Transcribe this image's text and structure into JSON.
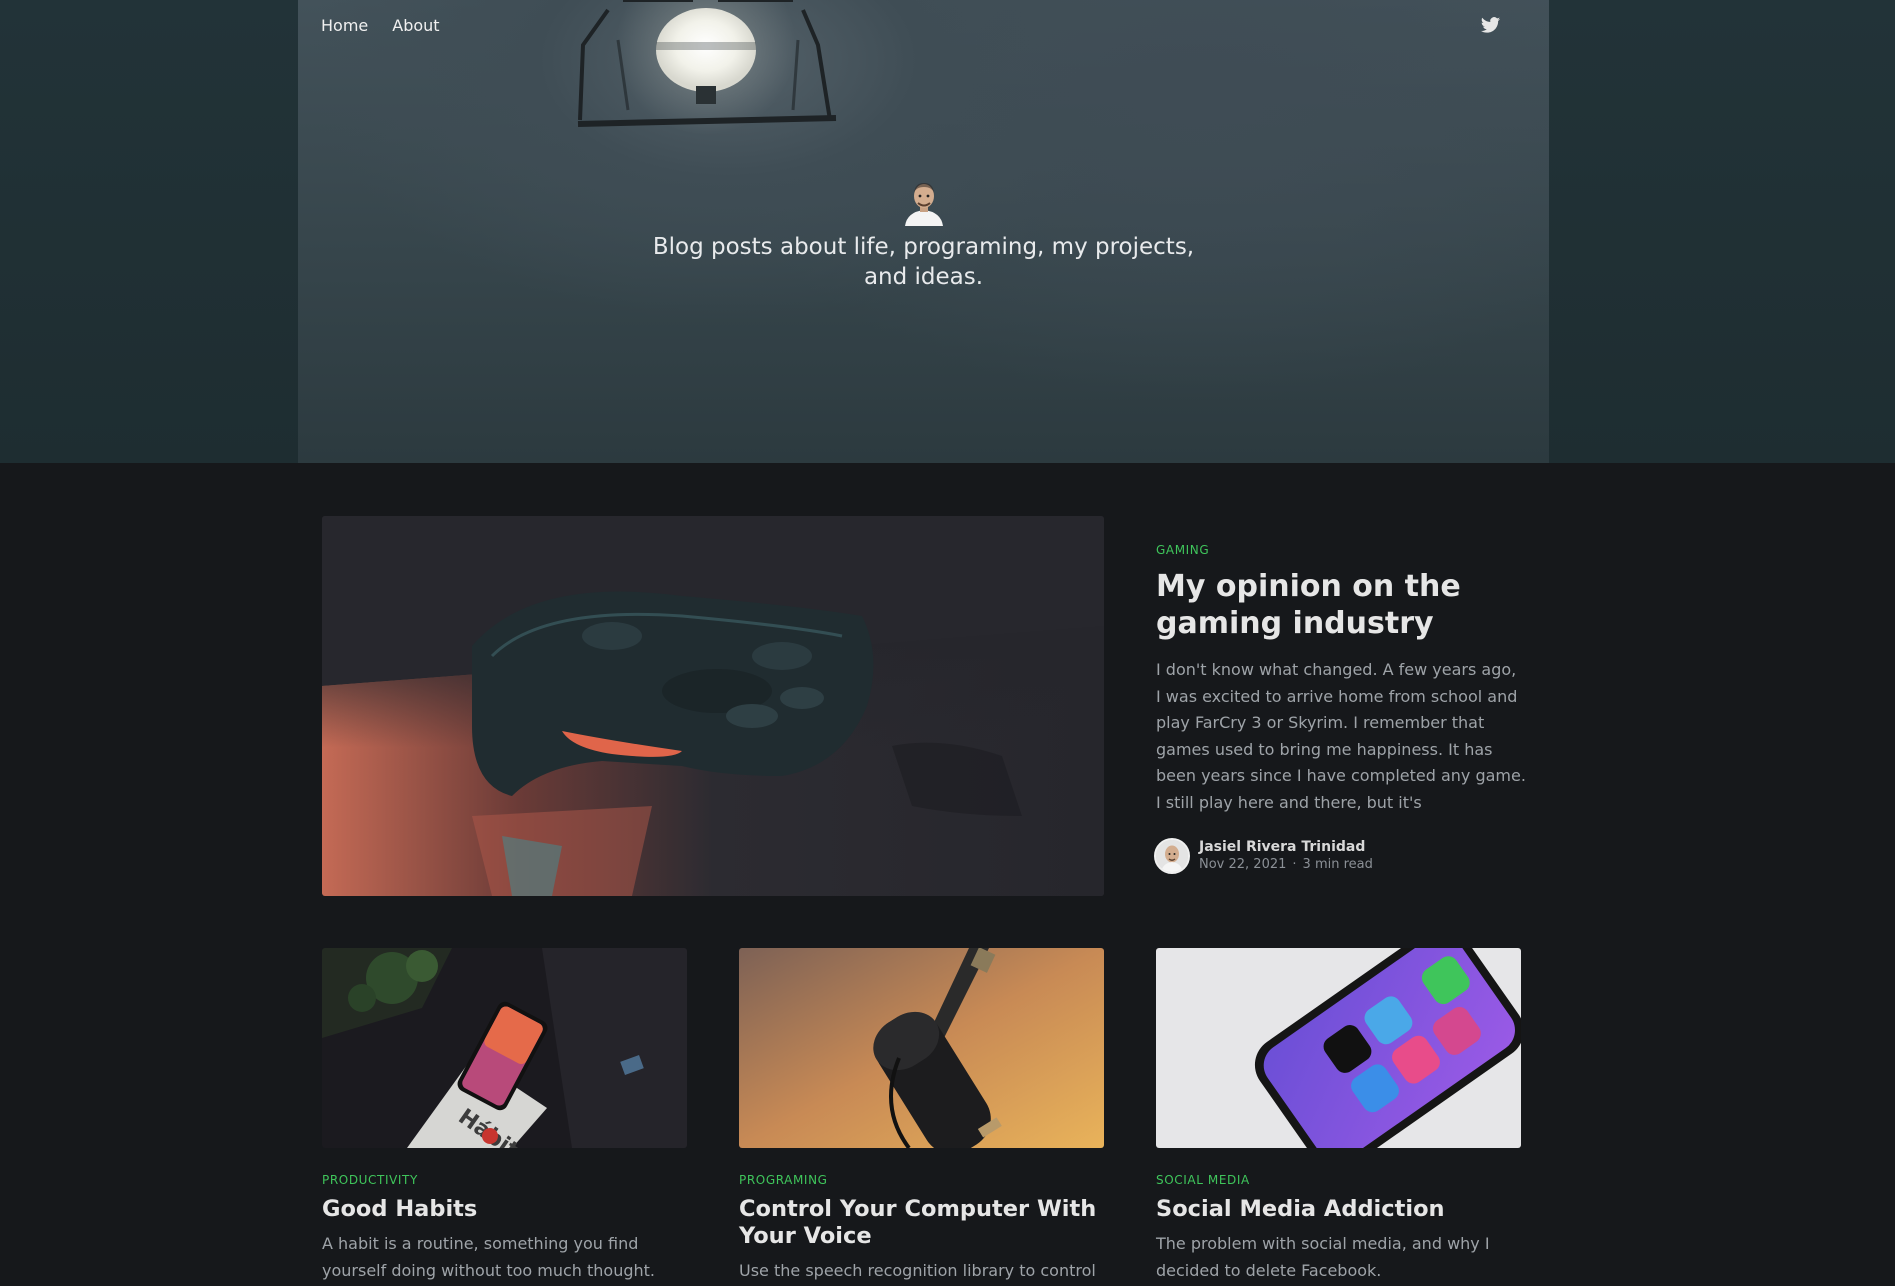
{
  "nav": {
    "home_label": "Home",
    "about_label": "About",
    "twitter_icon": "twitter-icon"
  },
  "hero": {
    "description": "Blog posts about life, programing, my projects, and ideas."
  },
  "featured": {
    "tag": "GAMING",
    "title": "My opinion on the gaming industry",
    "excerpt": "I don't know what changed. A few years ago, I was excited to arrive home from school and play FarCry 3 or Skyrim. I remember that games used to bring me happiness. It has been years since I have completed any game. I still play here and there, but it's",
    "author": "Jasiel Rivera Trinidad",
    "date": "Nov 22, 2021",
    "separator": "·",
    "read_time": "3 min read"
  },
  "posts": [
    {
      "tag": "PRODUCTIVITY",
      "title": "Good Habits",
      "excerpt": "A habit is a routine, something you find yourself doing without too much thought."
    },
    {
      "tag": "PROGRAMING",
      "title": "Control Your Computer With Your Voice",
      "excerpt": "Use the speech recognition library to control your"
    },
    {
      "tag": "SOCIAL MEDIA",
      "title": "Social Media Addiction",
      "excerpt": "The problem with social media, and why I decided to delete Facebook."
    }
  ],
  "colors": {
    "tag_green": "#3fc55b",
    "background": "#16181b"
  }
}
